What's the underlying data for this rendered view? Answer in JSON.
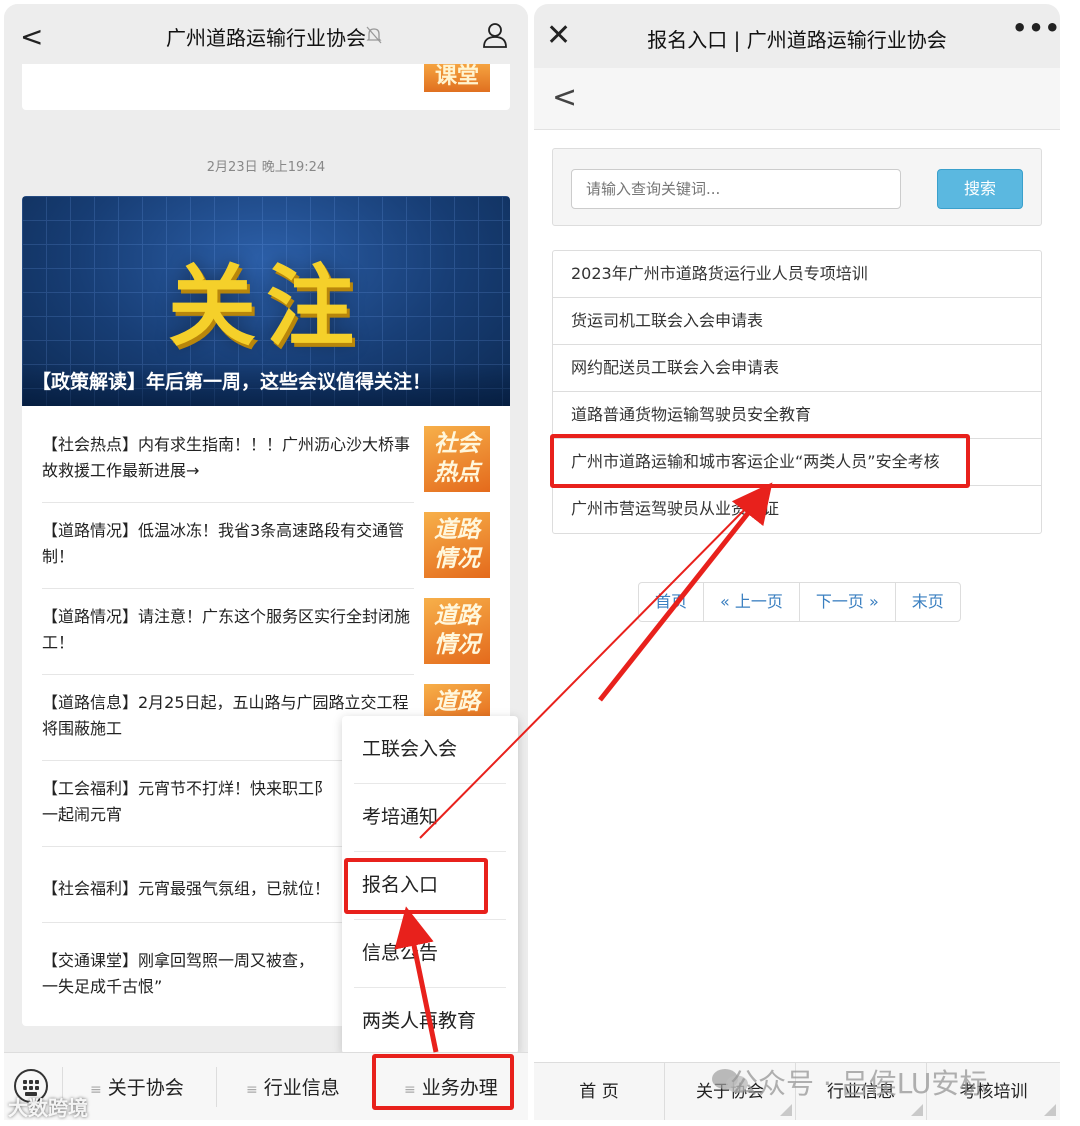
{
  "left": {
    "title": "广州道路运输行业协会",
    "back_glyph": "<",
    "prev_thumb": "课堂",
    "timestamp": "2月23日 晚上19:24",
    "hero": {
      "big_text": "关注",
      "caption": "【政策解读】年后第一周，这些会议值得关注！"
    },
    "news": [
      {
        "text": "【社会热点】内有求生指南！！！广州沥心沙大桥事故救援工作最新进展→",
        "thumb": "社会\n热点"
      },
      {
        "text": "【道路情况】低温冰冻！我省3条高速路段有交通管制！",
        "thumb": "道路\n情况"
      },
      {
        "text": "【道路情况】请注意！广东这个服务区实行全封闭施工！",
        "thumb": "道路\n情况"
      },
      {
        "text": "【道路信息】2月25日起，五山路与广园路立交工程将围蔽施工",
        "thumb": "道路"
      },
      {
        "text": "【工会福利】元宵节不打烊！快来职工阝\n一起闹元宵",
        "thumb": ""
      },
      {
        "text": "【社会福利】元宵最强气氛组，已就位！",
        "thumb": ""
      },
      {
        "text": "【交通课堂】刚拿回驾照一周又被查，\n一失足成千古恨”",
        "thumb": ""
      }
    ],
    "popup_menu": [
      "工联会入会",
      "考培通知",
      "报名入口",
      "信息公告",
      "两类人再教育"
    ],
    "bottom_tabs": [
      "关于协会",
      "行业信息",
      "业务办理"
    ],
    "hamburger": "≡",
    "watermark": "大数跨境"
  },
  "right": {
    "title": "报名入口 | 广州道路运输行业协会",
    "close_glyph": "✕",
    "more_glyph": "•••",
    "back_glyph": "<",
    "search": {
      "placeholder": "请输入查询关键词...",
      "button": "搜索"
    },
    "list": [
      "2023年广州市道路货运行业人员专项培训",
      "货运司机工联会入会申请表",
      "网约配送员工联会入会申请表",
      "道路普通货物运输驾驶员安全教育",
      "广州市道路运输和城市客运企业“两类人员”安全考核",
      "广州市营运驾驶员从业资格证"
    ],
    "pager": [
      "首页",
      "« 上一页",
      "下一页 »",
      "末页"
    ],
    "bottom_tabs": [
      "首  页",
      "关于协会",
      "行业信息",
      "考核培训"
    ],
    "watermark": "公众号 · 吕侯LU安标"
  },
  "colors": {
    "highlight": "#e8211c",
    "hero_text": "#f5d02a",
    "search_button": "#5bb8e0",
    "link": "#3a7fc0"
  },
  "icons": [
    "back-icon",
    "bell-muted-icon",
    "person-icon",
    "keyboard-icon",
    "close-icon",
    "more-icon",
    "wechat-icon"
  ]
}
